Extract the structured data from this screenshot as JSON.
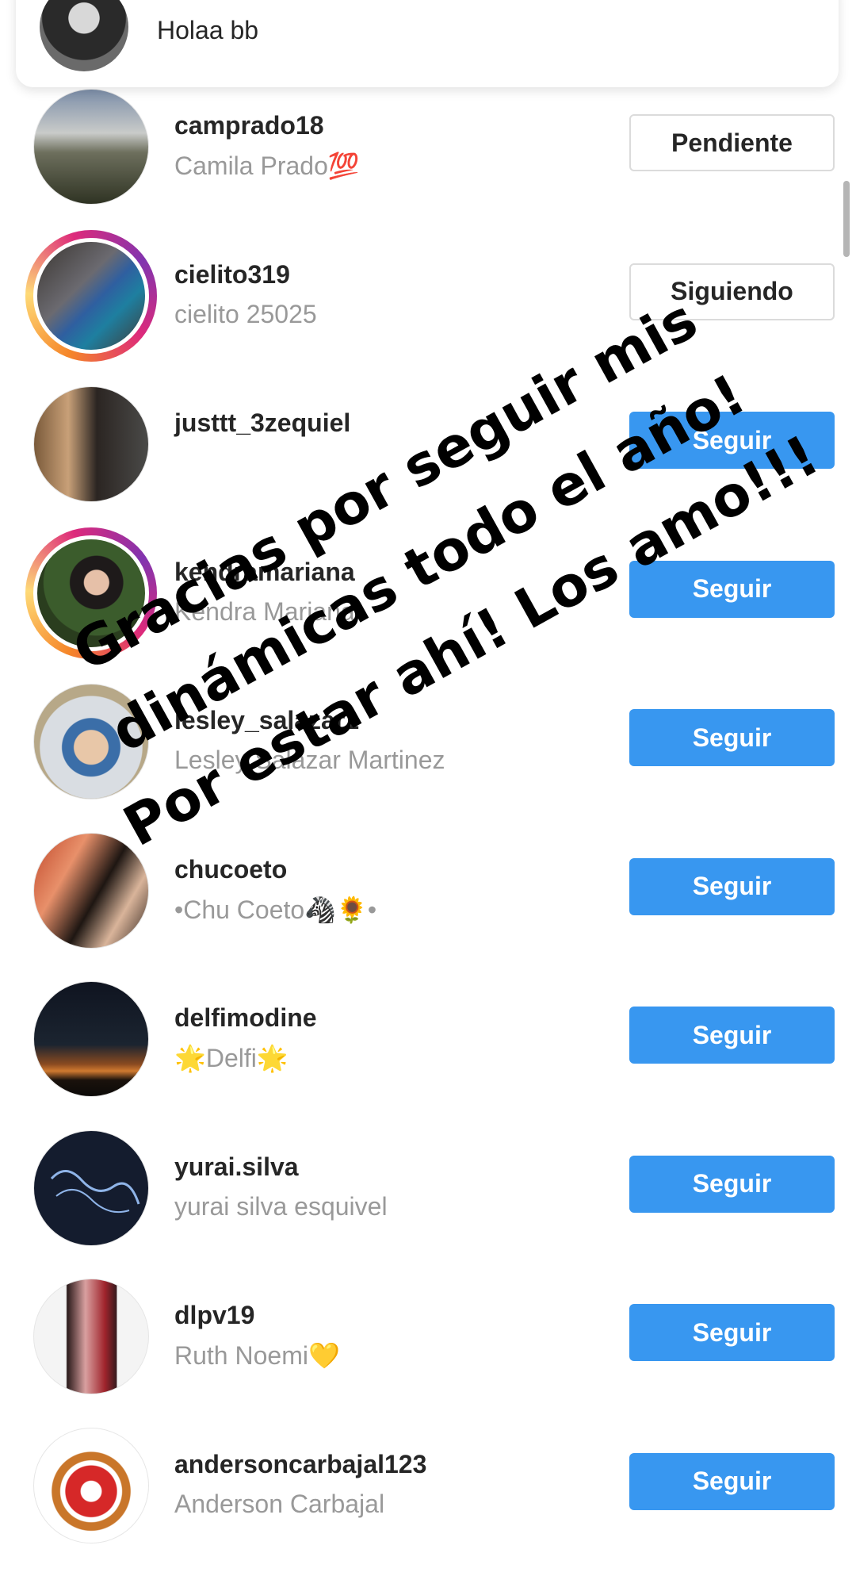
{
  "notification": {
    "message": "Holaa bb"
  },
  "story_caption": {
    "line1": "Gracias por seguir mis",
    "line2": "dinámicas todo el año!",
    "line3": "Por estar ahí! Los amo!!!"
  },
  "colors": {
    "primary_button": "#3897f0",
    "outline_border": "#dbdbdb",
    "secondary_text": "#999999"
  },
  "rows": [
    {
      "username": "camprado18",
      "fullname": "Camila Prado💯",
      "button": "Pendiente",
      "button_style": "outline",
      "story_ring": false,
      "avatar_icon": "mountain-photo"
    },
    {
      "username": "cielito319",
      "fullname": "cielito 25025",
      "button": "Siguiendo",
      "button_style": "outline",
      "story_ring": true,
      "avatar_icon": "person-photo"
    },
    {
      "username": "justtt_3zequiel",
      "fullname": "",
      "button": "Seguir",
      "button_style": "primary",
      "story_ring": false,
      "avatar_icon": "selfie-photo"
    },
    {
      "username": "kendramariana",
      "fullname": "Kendra Mariana",
      "button": "Seguir",
      "button_style": "primary",
      "story_ring": true,
      "avatar_icon": "person-photo"
    },
    {
      "username": "lesley_salazar1",
      "fullname": "Lesley Salazar Martinez",
      "button": "Seguir",
      "button_style": "primary",
      "story_ring": false,
      "avatar_icon": "person-photo"
    },
    {
      "username": "chucoeto",
      "fullname": "•Chu Coeto🦓🌻•",
      "button": "Seguir",
      "button_style": "primary",
      "story_ring": false,
      "avatar_icon": "person-photo"
    },
    {
      "username": "delfimodine",
      "fullname": "🌟Delfi🌟",
      "button": "Seguir",
      "button_style": "primary",
      "story_ring": false,
      "avatar_icon": "sunset-photo"
    },
    {
      "username": "yurai.silva",
      "fullname": "yurai silva esquivel",
      "button": "Seguir",
      "button_style": "primary",
      "story_ring": false,
      "avatar_icon": "queen-text-photo"
    },
    {
      "username": "dlpv19",
      "fullname": "Ruth Noemi💛",
      "button": "Seguir",
      "button_style": "primary",
      "story_ring": false,
      "avatar_icon": "person-photo"
    },
    {
      "username": "andersoncarbajal123",
      "fullname": "Anderson Carbajal",
      "button": "Seguir",
      "button_style": "primary",
      "story_ring": false,
      "avatar_icon": "christmas-photo"
    }
  ]
}
